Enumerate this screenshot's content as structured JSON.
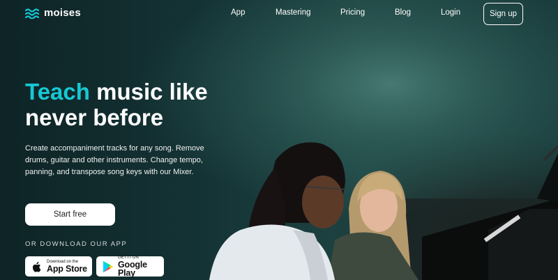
{
  "brand": {
    "name": "moises",
    "accent_color": "#16c8d4"
  },
  "nav": {
    "links": [
      "App",
      "Mastering",
      "Pricing",
      "Blog",
      "Login"
    ],
    "signup_label": "Sign up"
  },
  "hero": {
    "headline_accent": "Teach",
    "headline_rest_1": "music like",
    "headline_rest_2": "never before",
    "subtext": "Create accompaniment tracks for any song. Remove drums, guitar and other instruments. Change tempo, panning, and transpose song keys with our Mixer.",
    "cta_label": "Start free",
    "download_label": "OR DOWNLOAD OUR APP"
  },
  "stores": {
    "apple": {
      "small": "Download on the",
      "big": "App Store",
      "icon": "apple-icon"
    },
    "google": {
      "small": "GET IT ON",
      "big": "Google Play",
      "icon": "google-play-icon"
    }
  }
}
